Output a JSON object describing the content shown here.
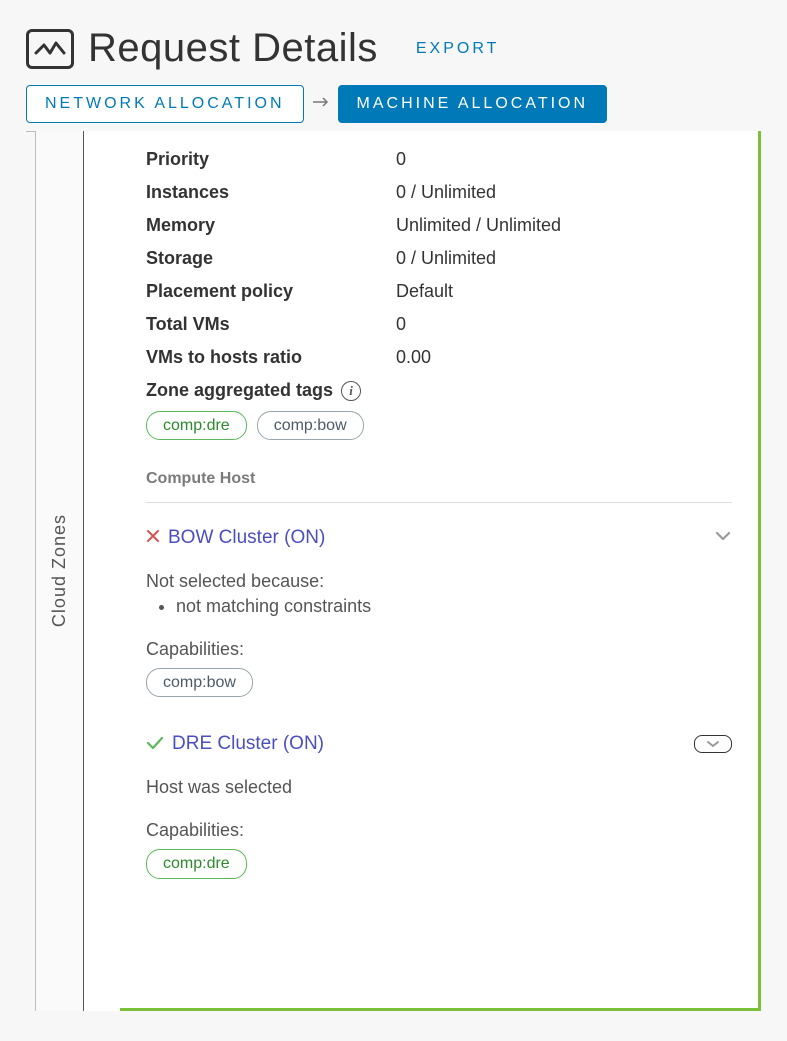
{
  "header": {
    "title": "Request Details",
    "export_label": "EXPORT"
  },
  "tabs": {
    "network": "NETWORK ALLOCATION",
    "machine": "MACHINE ALLOCATION"
  },
  "sidebar": {
    "vertical_label": "Cloud Zones"
  },
  "zone": {
    "kv": [
      {
        "k": "Priority",
        "v": "0"
      },
      {
        "k": "Instances",
        "v": "0 / Unlimited"
      },
      {
        "k": "Memory",
        "v": "Unlimited / Unlimited"
      },
      {
        "k": "Storage",
        "v": "0 / Unlimited"
      },
      {
        "k": "Placement policy",
        "v": "Default"
      },
      {
        "k": "Total VMs",
        "v": "0"
      },
      {
        "k": "VMs to hosts ratio",
        "v": "0.00"
      }
    ],
    "aggregated_label": "Zone aggregated tags",
    "aggregated_tags": {
      "green": "comp:dre",
      "grey": "comp:bow"
    }
  },
  "compute": {
    "section_label": "Compute Host",
    "hosts": {
      "bow": {
        "name": "BOW Cluster (ON)",
        "reason_header": "Not selected because:",
        "reason_bullet": "not matching constraints",
        "cap_label": "Capabilities:",
        "cap_tag": "comp:bow"
      },
      "dre": {
        "name": "DRE Cluster (ON)",
        "status_line": "Host was selected",
        "cap_label": "Capabilities:",
        "cap_tag": "comp:dre"
      }
    }
  }
}
